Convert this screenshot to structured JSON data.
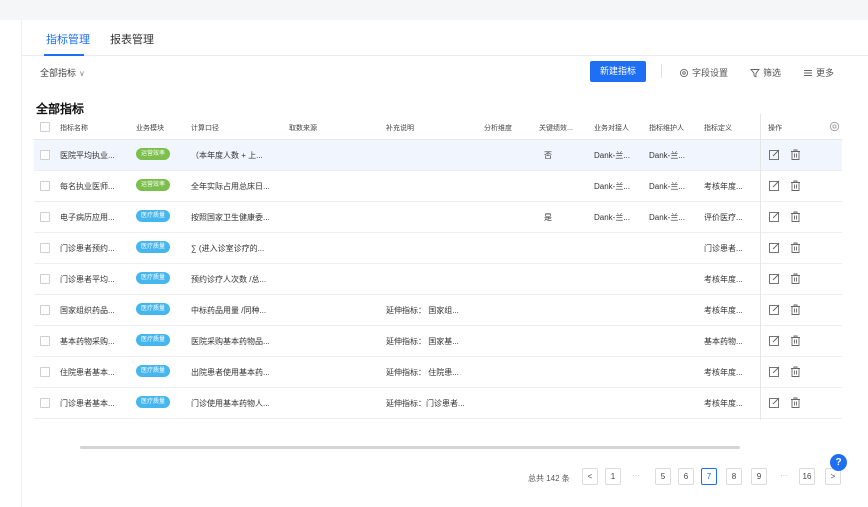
{
  "tabs": [
    {
      "label": "指标管理",
      "active": true
    },
    {
      "label": "报表管理",
      "active": false
    }
  ],
  "filter": {
    "label": "全部指标"
  },
  "toolbar": {
    "new_button": "新建指标",
    "field_settings": "字段设置",
    "filter": "筛选",
    "more": "更多"
  },
  "section_title": "全部指标",
  "columns": [
    "指标名称",
    "业务模块",
    "计算口径",
    "取数来源",
    "补充说明",
    "分析维度",
    "关键绩效...",
    "业务对接人",
    "指标维护人",
    "指标定义",
    "操作"
  ],
  "rows": [
    {
      "name": "医院平均执业...",
      "module": "运营效率",
      "module_color": "green",
      "calc": "（本年度人数 + 上...",
      "source": "",
      "note": "",
      "dim": "",
      "kpi": "否",
      "biz": "Dank-兰...",
      "maint": "Dank-兰...",
      "def": ""
    },
    {
      "name": "每名执业医师...",
      "module": "运营效率",
      "module_color": "green",
      "calc": "全年实际占用总床日...",
      "source": "",
      "note": "",
      "dim": "",
      "kpi": "",
      "biz": "Dank-兰...",
      "maint": "Dank-兰...",
      "def": "考核年度..."
    },
    {
      "name": "电子病历应用...",
      "module": "医疗质量",
      "module_color": "blue",
      "calc": "按照国家卫生健康委...",
      "source": "",
      "note": "",
      "dim": "",
      "kpi": "是",
      "biz": "Dank-兰...",
      "maint": "Dank-兰...",
      "def": "评价医疗..."
    },
    {
      "name": "门诊患者预约...",
      "module": "医疗质量",
      "module_color": "blue",
      "calc": "∑ (进入诊室诊疗的...",
      "source": "",
      "note": "",
      "dim": "",
      "kpi": "",
      "biz": "",
      "maint": "",
      "def": "门诊患者..."
    },
    {
      "name": "门诊患者平均...",
      "module": "医疗质量",
      "module_color": "blue",
      "calc": "预约诊疗人次数 /总...",
      "source": "",
      "note": "",
      "dim": "",
      "kpi": "",
      "biz": "",
      "maint": "",
      "def": "考核年度..."
    },
    {
      "name": "国家组织药品...",
      "module": "医疗质量",
      "module_color": "blue",
      "calc": "中标药品用量 /同种...",
      "source": "",
      "note": "延伸指标：  国家组...",
      "dim": "",
      "kpi": "",
      "biz": "",
      "maint": "",
      "def": "考核年度..."
    },
    {
      "name": "基本药物采购...",
      "module": "医疗质量",
      "module_color": "blue",
      "calc": "医院采购基本药物品...",
      "source": "",
      "note": "延伸指标：  国家基...",
      "dim": "",
      "kpi": "",
      "biz": "",
      "maint": "",
      "def": "基本药物..."
    },
    {
      "name": "住院患者基本...",
      "module": "医疗质量",
      "module_color": "blue",
      "calc": "出院患者使用基本药...",
      "source": "",
      "note": "延伸指标：  住院患...",
      "dim": "",
      "kpi": "",
      "biz": "",
      "maint": "",
      "def": "考核年度..."
    },
    {
      "name": "门诊患者基本...",
      "module": "医疗质量",
      "module_color": "blue",
      "calc": "门诊使用基本药物人...",
      "source": "",
      "note": "延伸指标：门诊患者...",
      "dim": "",
      "kpi": "",
      "biz": "",
      "maint": "",
      "def": "考核年度..."
    }
  ],
  "pagination": {
    "total": "总共 142 条",
    "prev": "<",
    "next": ">",
    "pages": [
      "1",
      "···",
      "5",
      "6",
      "7",
      "8",
      "9",
      "···",
      "16"
    ],
    "current": "7"
  },
  "help": "?"
}
